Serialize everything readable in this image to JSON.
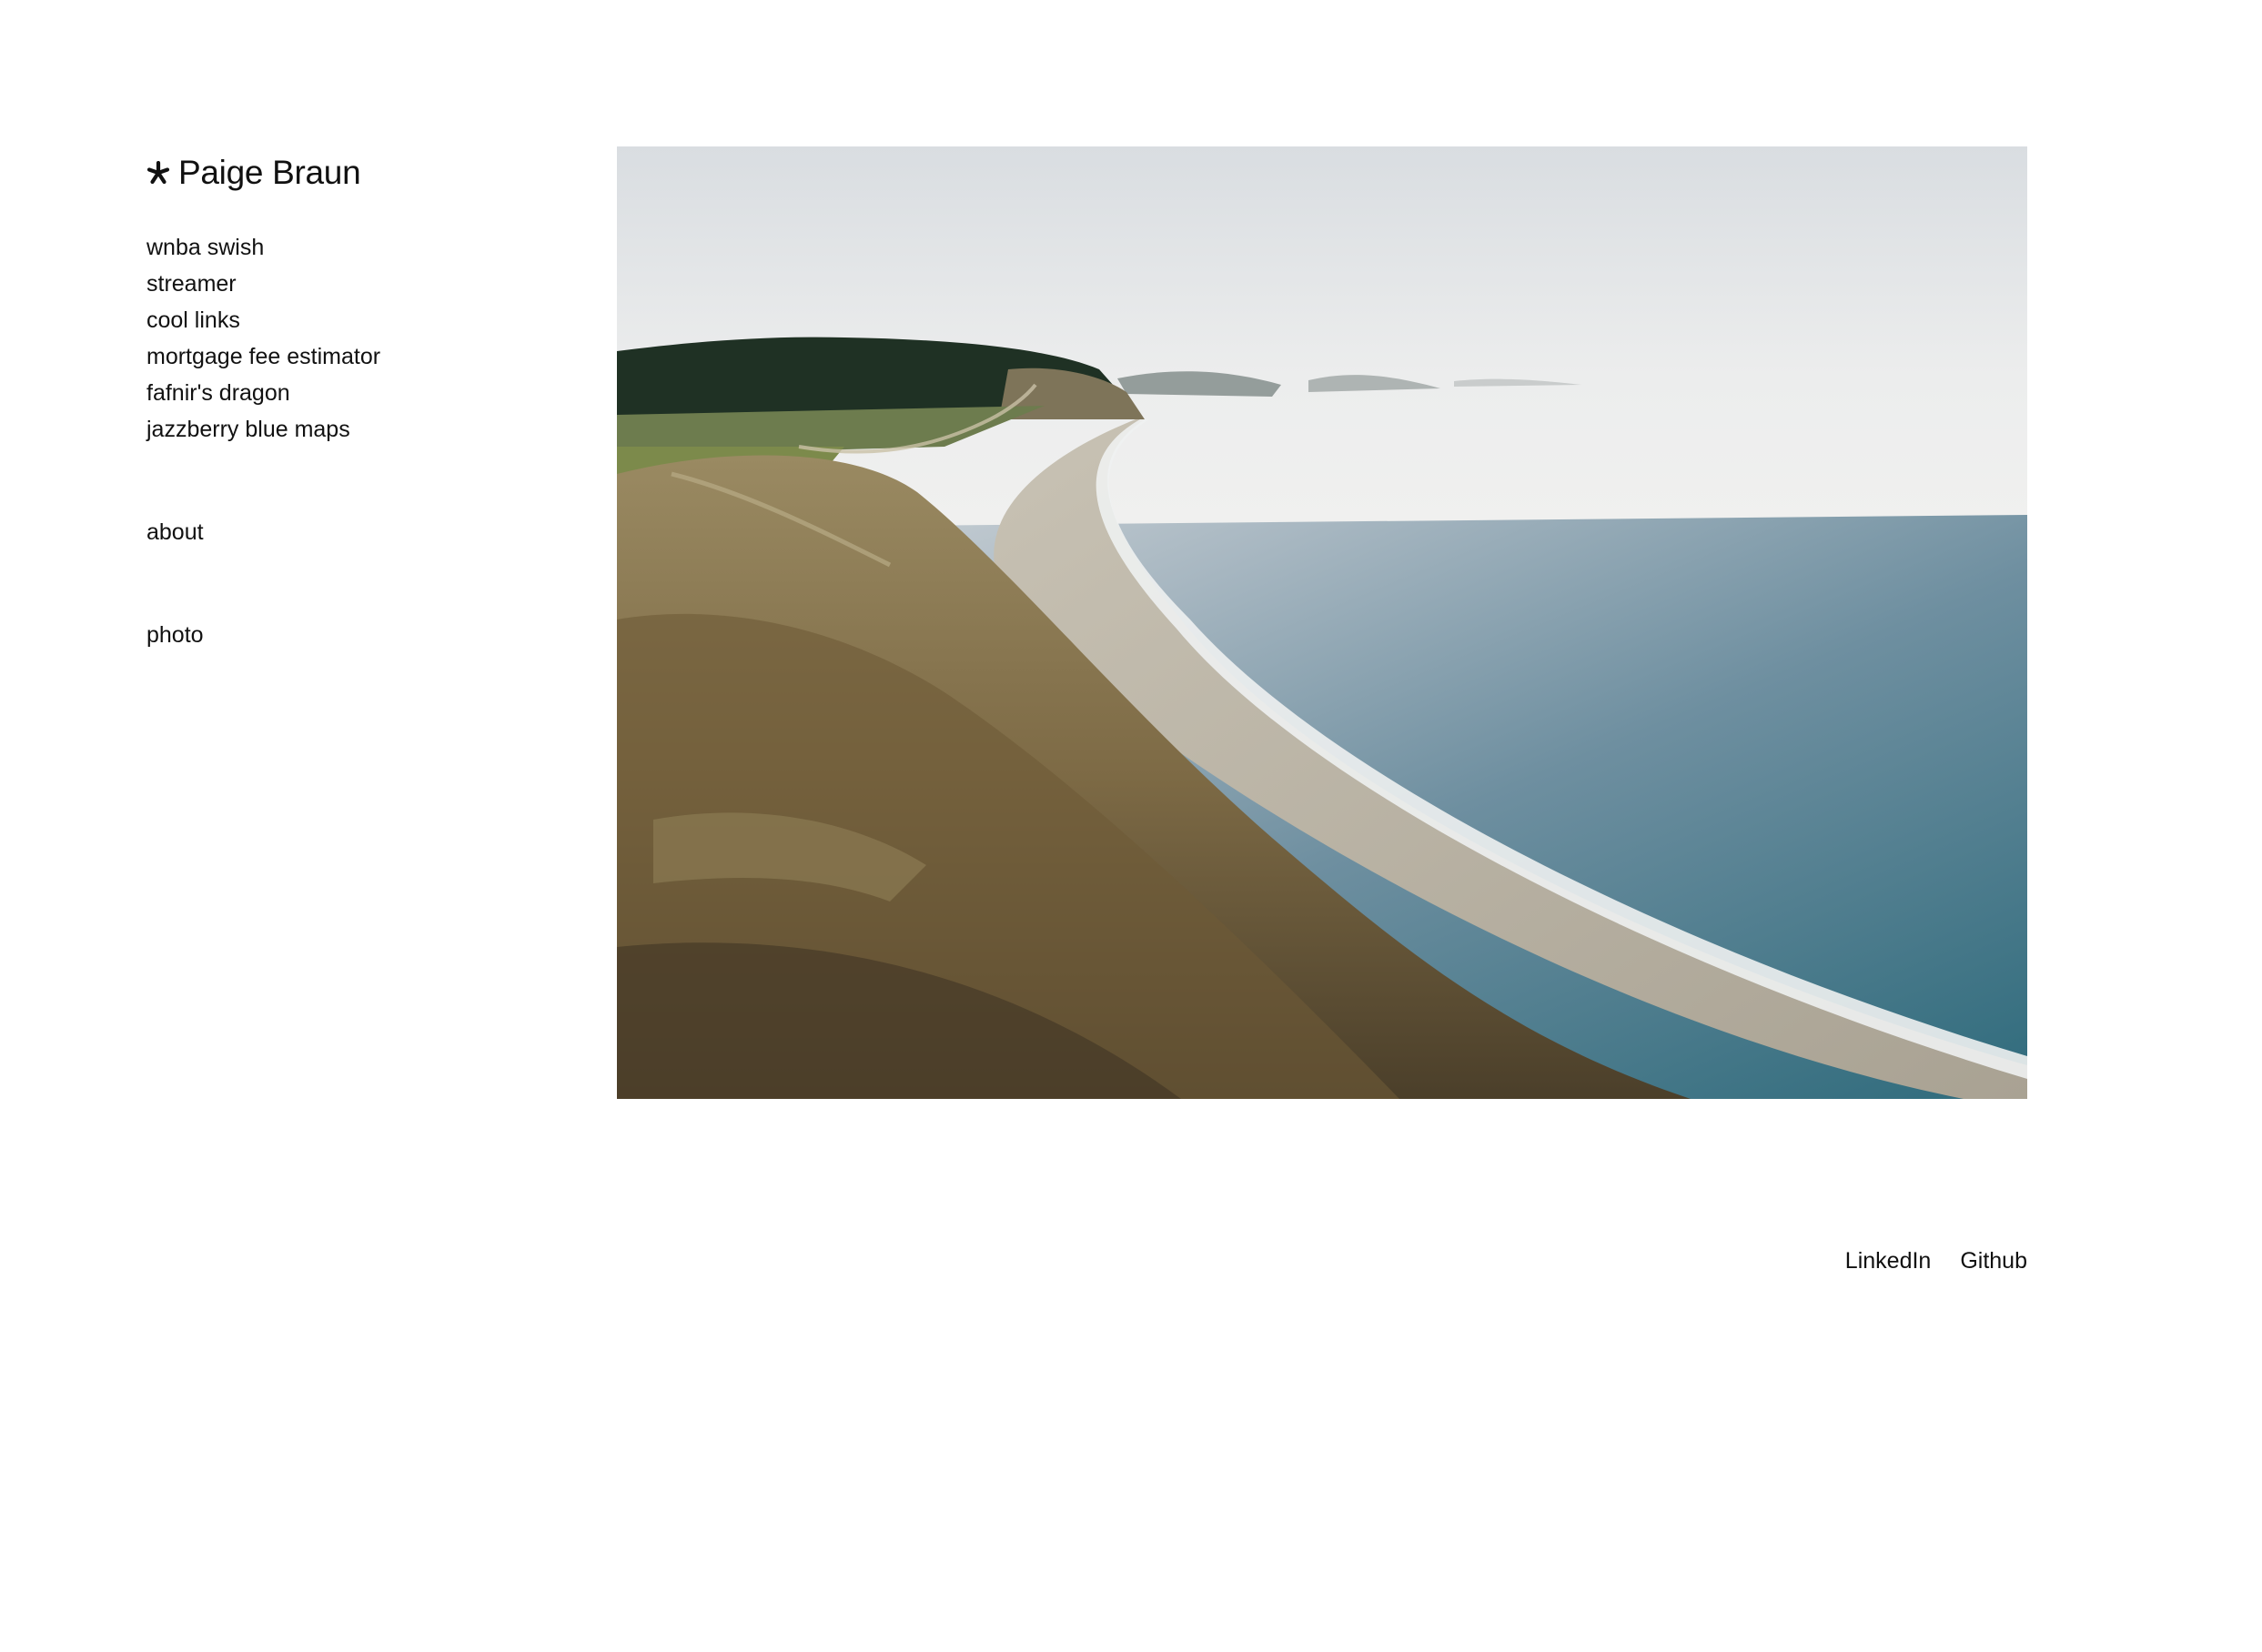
{
  "brand": {
    "icon": "asterisk-icon",
    "name": "Paige Braun"
  },
  "nav": {
    "projects": [
      {
        "label": "wnba swish"
      },
      {
        "label": "streamer"
      },
      {
        "label": "cool links"
      },
      {
        "label": "mortgage fee estimator"
      },
      {
        "label": "fafnir's dragon"
      },
      {
        "label": "jazzberry blue maps"
      }
    ],
    "about": {
      "label": "about"
    },
    "photo": {
      "label": "photo"
    }
  },
  "main_image": {
    "subject": "coastal bluff overlooking a curved beach and calm sea"
  },
  "footer": {
    "links": [
      {
        "label": "LinkedIn"
      },
      {
        "label": "Github"
      }
    ]
  }
}
